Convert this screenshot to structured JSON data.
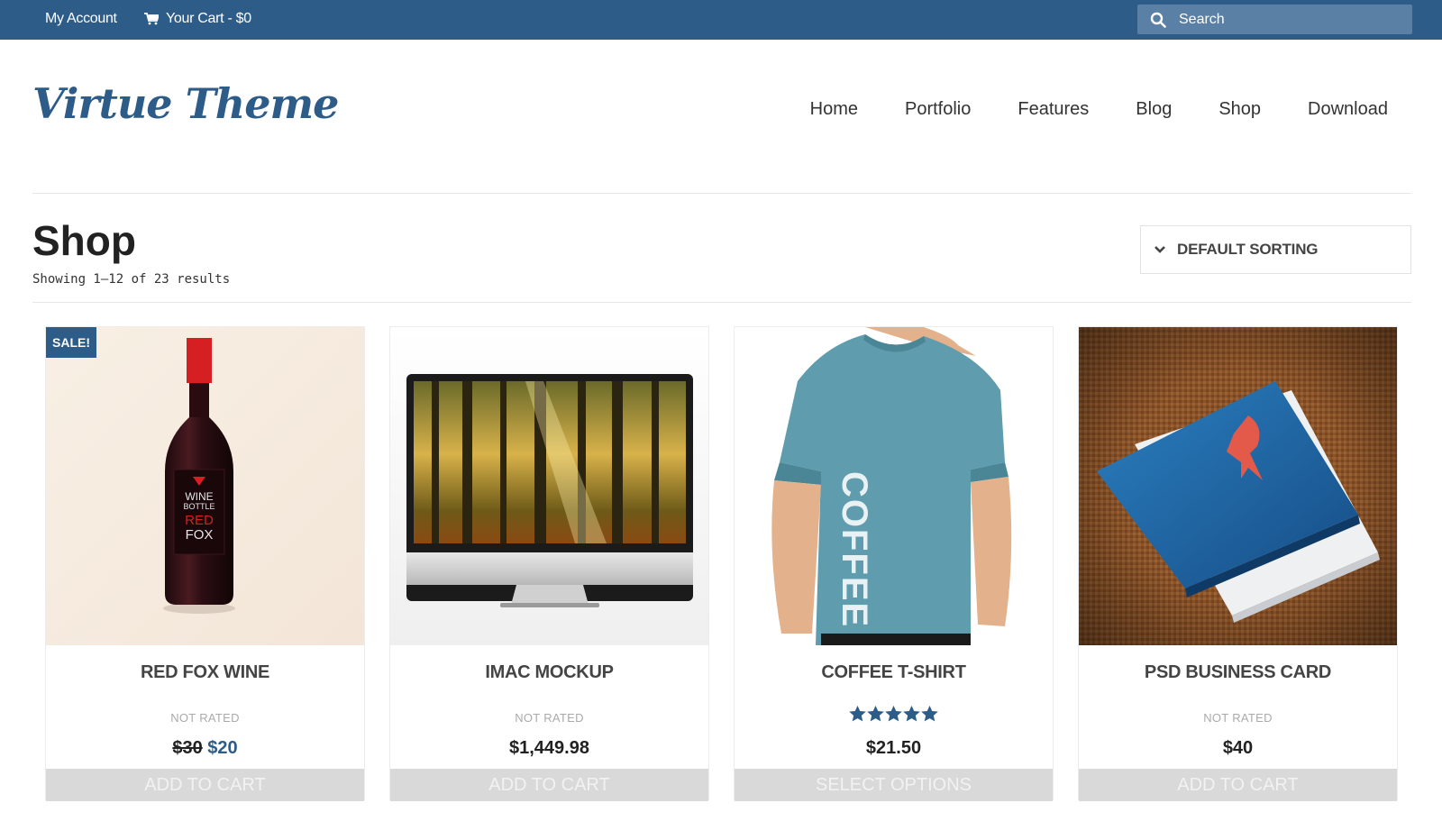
{
  "topbar": {
    "account_label": "My Account",
    "cart_label": "Your Cart - $0",
    "search_placeholder": "Search"
  },
  "header": {
    "logo_text": "Virtue Theme",
    "nav": [
      "Home",
      "Portfolio",
      "Features",
      "Blog",
      "Shop",
      "Download"
    ]
  },
  "page": {
    "title": "Shop",
    "result_count": "Showing 1–12 of 23 results",
    "sorting_label": "DEFAULT SORTING"
  },
  "products": [
    {
      "name": "RED FOX WINE",
      "badge": "SALE!",
      "rating_text": "NOT RATED",
      "old_price": "$30",
      "price": "$20",
      "button": "ADD TO CART"
    },
    {
      "name": "IMAC MOCKUP",
      "rating_text": "NOT RATED",
      "price": "$1,449.98",
      "button": "ADD TO CART"
    },
    {
      "name": "COFFEE T-SHIRT",
      "rating": 5,
      "price": "$21.50",
      "button": "SELECT OPTIONS",
      "shirt_print": "COFFEE"
    },
    {
      "name": "PSD BUSINESS CARD",
      "rating_text": "NOT RATED",
      "price": "$40",
      "button": "ADD TO CART"
    }
  ],
  "wine_label": {
    "line1": "WINE",
    "line2": "BOTTLE",
    "line3": "RED",
    "line4": "FOX"
  },
  "colors": {
    "brand": "#2d5c88",
    "button_bg": "#d9d9d9",
    "sale_badge": "#2d5c88"
  }
}
